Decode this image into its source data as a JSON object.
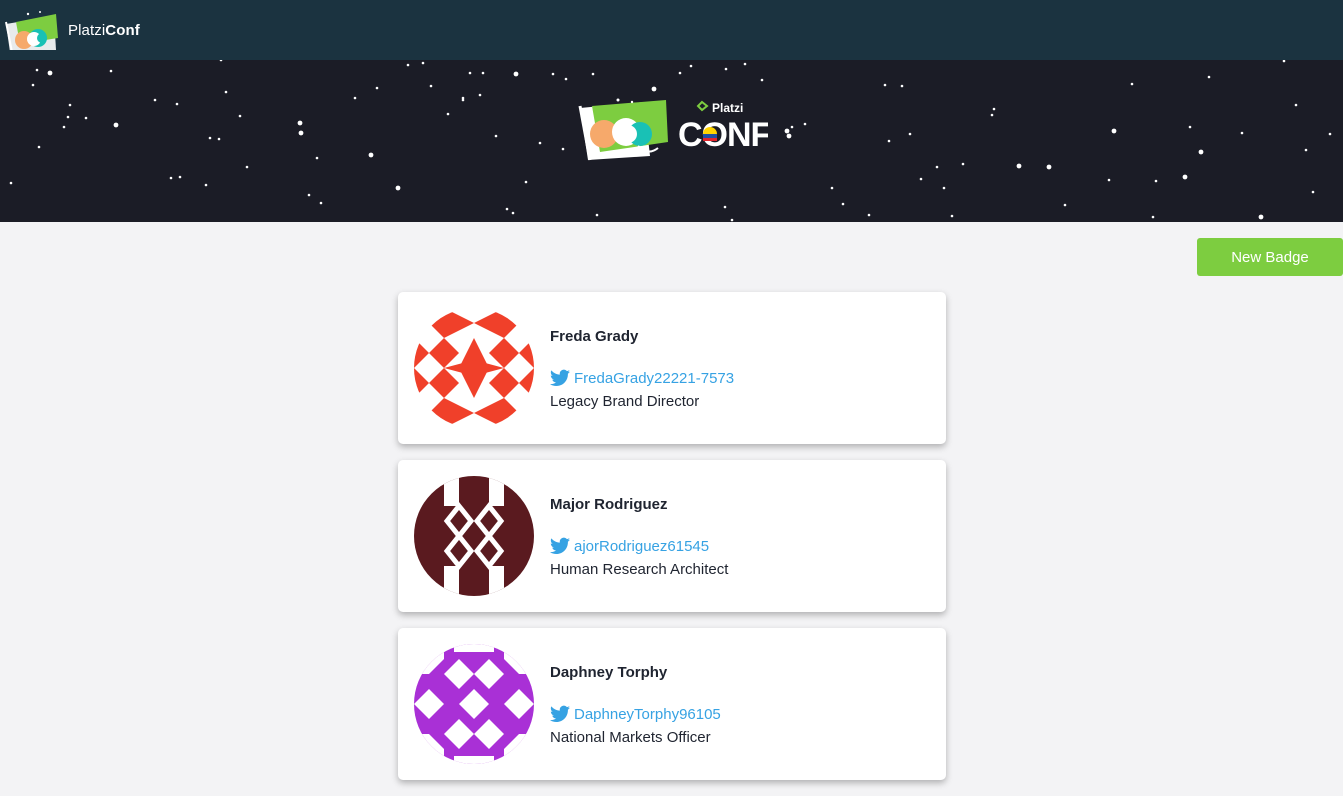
{
  "navbar": {
    "brand_light": "Platzi",
    "brand_bold": "Conf",
    "logo_icon": "platziconf-logo-icon"
  },
  "hero": {
    "logo_small_text": "Platzi",
    "logo_big_text": "CONF"
  },
  "actions": {
    "new_badge_label": "New Badge"
  },
  "colors": {
    "navbar_bg": "#1b3340",
    "hero_bg": "#1b1c26",
    "accent_green": "#7dcd40",
    "twitter_blue": "#36a2e3",
    "page_bg": "#f3f3f5"
  },
  "badges": [
    {
      "name": "Freda Grady",
      "twitter": "FredaGrady22221-7573",
      "title": "Legacy Brand Director",
      "avatar_color": "#f0402a",
      "twitter_icon": "twitter-bird-icon"
    },
    {
      "name": "Major Rodriguez",
      "twitter": "ajorRodriguez61545",
      "title": "Human Research Architect",
      "avatar_color": "#5a1a1f",
      "twitter_icon": "twitter-bird-icon"
    },
    {
      "name": "Daphney Torphy",
      "twitter": "DaphneyTorphy96105",
      "title": "National Markets Officer",
      "avatar_color": "#a930d6",
      "twitter_icon": "twitter-bird-icon"
    }
  ]
}
